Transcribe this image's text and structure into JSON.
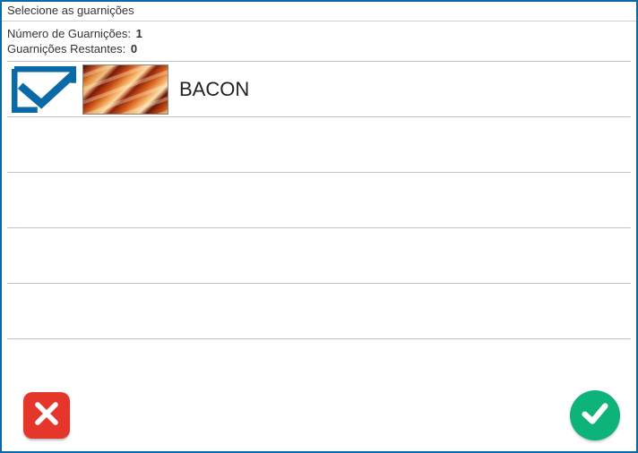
{
  "window": {
    "title": "Selecione as guarnições"
  },
  "info": {
    "total_label": "Número de Guarnições:",
    "total_value": "1",
    "remaining_label": "Guarnições Restantes:",
    "remaining_value": "0"
  },
  "items": [
    {
      "name": "BACON",
      "selected": true,
      "image": "bacon"
    },
    {
      "name": "",
      "selected": false,
      "image": ""
    },
    {
      "name": "",
      "selected": false,
      "image": ""
    },
    {
      "name": "",
      "selected": false,
      "image": ""
    },
    {
      "name": "",
      "selected": false,
      "image": ""
    }
  ],
  "colors": {
    "accent": "#0a6aa8",
    "check": "#0a6aa8",
    "confirm": "#0eb37a",
    "cancel": "#e5362c"
  },
  "icons": {
    "selected_check": "check-box",
    "cancel": "cross",
    "confirm": "check-circle"
  }
}
